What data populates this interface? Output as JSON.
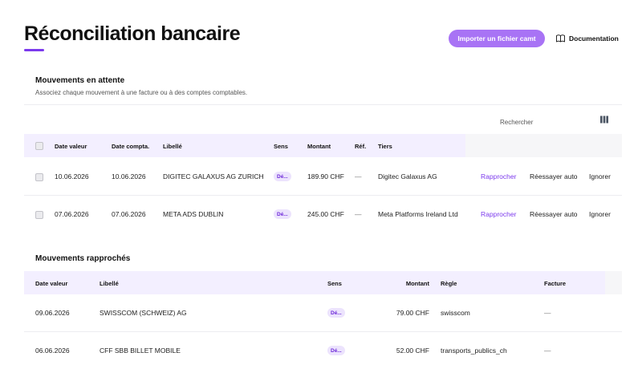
{
  "page": {
    "title": "Réconciliation bancaire",
    "import_label": "Importer un fichier camt",
    "doc_label": "Documentation"
  },
  "pending": {
    "title": "Mouvements en attente",
    "subtitle": "Associez chaque mouvement à une facture ou à des comptes comptables.",
    "search_placeholder": "Rechercher",
    "columns": [
      "Date valeur",
      "Date compta.",
      "Libellé",
      "Sens",
      "Montant",
      "Réf.",
      "Tiers"
    ],
    "rows": [
      {
        "date_valeur": "10.06.2026",
        "date_compta": "10.06.2026",
        "libelle": "DIGITEC GALAXUS AG ZURICH",
        "sens": "Dé...",
        "montant": "189.90 CHF",
        "ref": "—",
        "tiers": "Digitec Galaxus AG",
        "action_match": "Rapprocher",
        "action_retry": "Réessayer auto",
        "action_ignore": "Ignorer"
      },
      {
        "date_valeur": "07.06.2026",
        "date_compta": "07.06.2026",
        "libelle": "META ADS DUBLIN",
        "sens": "Dé...",
        "montant": "245.00 CHF",
        "ref": "—",
        "tiers": "Meta Platforms Ireland Ltd",
        "action_match": "Rapprocher",
        "action_retry": "Réessayer auto",
        "action_ignore": "Ignorer"
      }
    ]
  },
  "matched": {
    "title": "Mouvements rapprochés",
    "columns": [
      "Date valeur",
      "Libellé",
      "Sens",
      "Montant",
      "Règle",
      "Facture"
    ],
    "rows": [
      {
        "date_valeur": "09.06.2026",
        "libelle": "SWISSCOM (SCHWEIZ) AG",
        "sens": "Dé...",
        "montant": "79.00 CHF",
        "regle": "swisscom",
        "facture": "—"
      },
      {
        "date_valeur": "06.06.2026",
        "libelle": "CFF SBB BILLET MOBILE",
        "sens": "Dé...",
        "montant": "52.00 CHF",
        "regle": "transports_publics_ch",
        "facture": "—"
      }
    ]
  },
  "colors": {
    "accent": "#7c3aed",
    "button": "#a873f5",
    "header_bg": "#f3efff",
    "badge_bg": "#ece3fd"
  },
  "icons": {
    "doc": "book-icon",
    "columns": "columns-icon"
  }
}
